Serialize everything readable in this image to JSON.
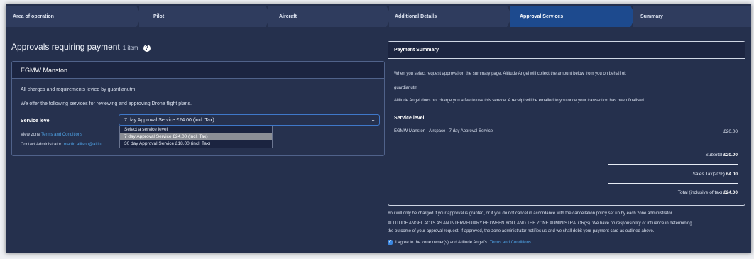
{
  "steps": [
    {
      "label": "Area of operation",
      "active": false
    },
    {
      "label": "Pilot",
      "active": false
    },
    {
      "label": "Aircraft",
      "active": false
    },
    {
      "label": "Additional Details",
      "active": false
    },
    {
      "label": "Approval Services",
      "active": true
    },
    {
      "label": "Summary",
      "active": false
    }
  ],
  "left": {
    "heading": "Approvals requiring payment",
    "count": "1 item",
    "help_icon": "?",
    "zone": {
      "name": "EGMW Manston",
      "charges_line": "All charges and requirements levied by guardianutm",
      "offer_line": "We offer the following services for reviewing and approving Drone flight plans.",
      "service_level_label": "Service level",
      "selected_service": "7 day Approval Service £24.00 (incl. Tax)",
      "caret": "⌄",
      "view_zone_prefix": "View zone",
      "view_zone_link": "Terms and Conditions",
      "contact_prefix": "Contact Administrator:",
      "contact_link": "martin.allison@altitu",
      "options": [
        {
          "label": "Select a service level",
          "selected": false
        },
        {
          "label": "7 day Approval Service £24.00 (incl. Tax)",
          "selected": true
        },
        {
          "label": "30 day Approval Service £18.00 (incl. Tax)",
          "selected": false
        }
      ]
    }
  },
  "payment": {
    "title": "Payment Summary",
    "intro": "When you select request approval on the summary page, Altitude Angel will collect the amount below from you on behalf of:",
    "payee": "guardianutm",
    "no_fee": "Altitude Angel does not charge you a fee to use this service. A receipt will be emailed to you once your transaction has been finalised.",
    "service_level_heading": "Service level",
    "line_item": "EGMW Manston - Airspace - 7 day Approval Service",
    "line_amount": "£20.00",
    "subtotal_label": "Subtotal",
    "subtotal": "£20.00",
    "tax_label": "Sales Tax(20%)",
    "tax": "£4.00",
    "total_label": "Total (inclusive of tax)",
    "total": "£24.00"
  },
  "footer": {
    "charge_note": "You will only be charged if your approval is granted, or if you do not cancel in accordance with the cancellation policy set up by each zone administrator.",
    "intermediary_1": "ALTITUDE ANGEL ACTS AS AN INTERMEDIARY BETWEEN YOU, AND THE ZONE ADMINISTRATOR(S). We have no responsibility or influence in determining",
    "intermediary_2": "the outcome of your approval request. If approved, the zone administrator notifies us and we shall debit your payment card as outlined above.",
    "agree_prefix": "I agree to the zone owner(s) and Altitude Angel's",
    "agree_link": "Terms and Conditions",
    "check": "✓"
  }
}
